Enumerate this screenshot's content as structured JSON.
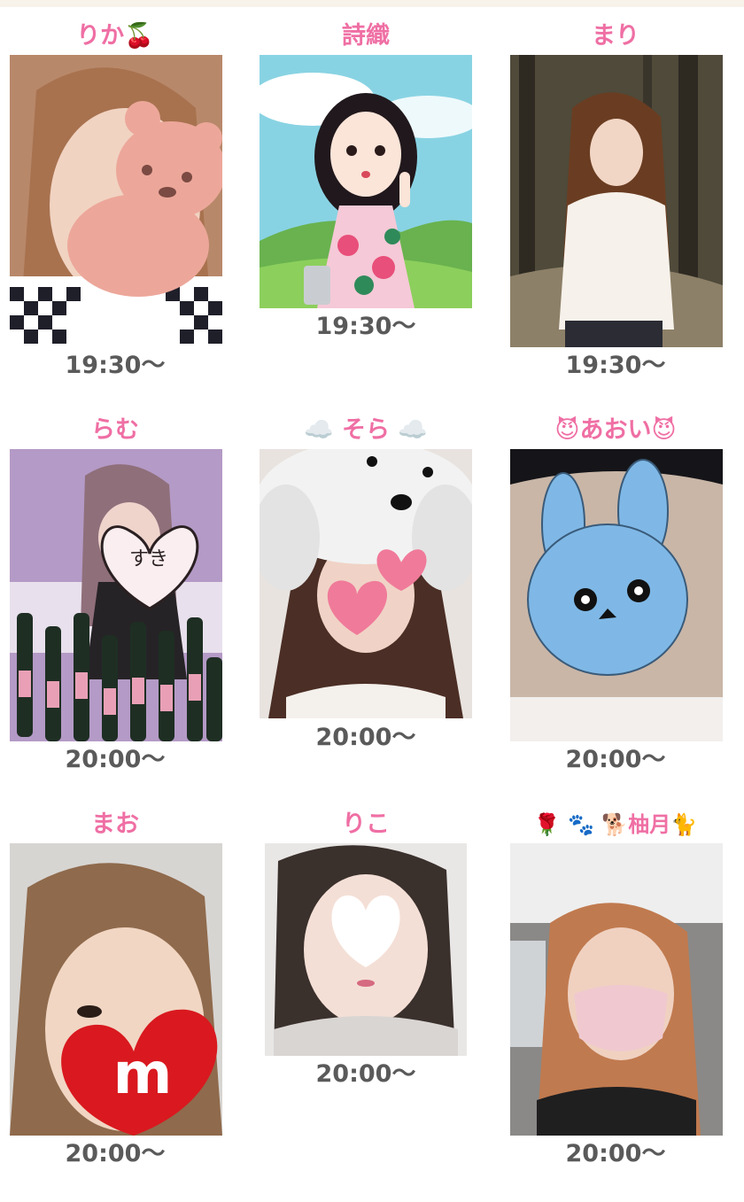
{
  "cast": [
    {
      "name": "りか🍒",
      "time": "19:30〜",
      "sticker": "bear-sticker-icon"
    },
    {
      "name": "詩織",
      "time": "19:30〜",
      "sticker": "illustrated-avatar"
    },
    {
      "name": "まり",
      "time": "19:30〜",
      "sticker": "face-blur"
    },
    {
      "name": "らむ",
      "time": "20:00〜",
      "sticker": "heart-sticker-icon",
      "sticker_text": "すき"
    },
    {
      "name": "☁️ そら ☁️",
      "time": "20:00〜",
      "sticker": "poodle-hat-sticker-icon"
    },
    {
      "name": "😈あおい😈",
      "time": "20:00〜",
      "sticker": "rabbit-sticker-icon"
    },
    {
      "name": "まお",
      "time": "20:00〜",
      "sticker": "heart-m-sticker-icon",
      "sticker_text": "m"
    },
    {
      "name": "りこ",
      "time": "20:00〜",
      "sticker": "white-heart-sticker-icon"
    },
    {
      "name": "🌹 🐾 🐕柚月🐈",
      "time": "20:00〜",
      "sticker": "pink-mask"
    }
  ],
  "colors": {
    "name": "#ef6fa4",
    "time": "#5a5a5a",
    "top_strip": "#f7f2ea"
  }
}
